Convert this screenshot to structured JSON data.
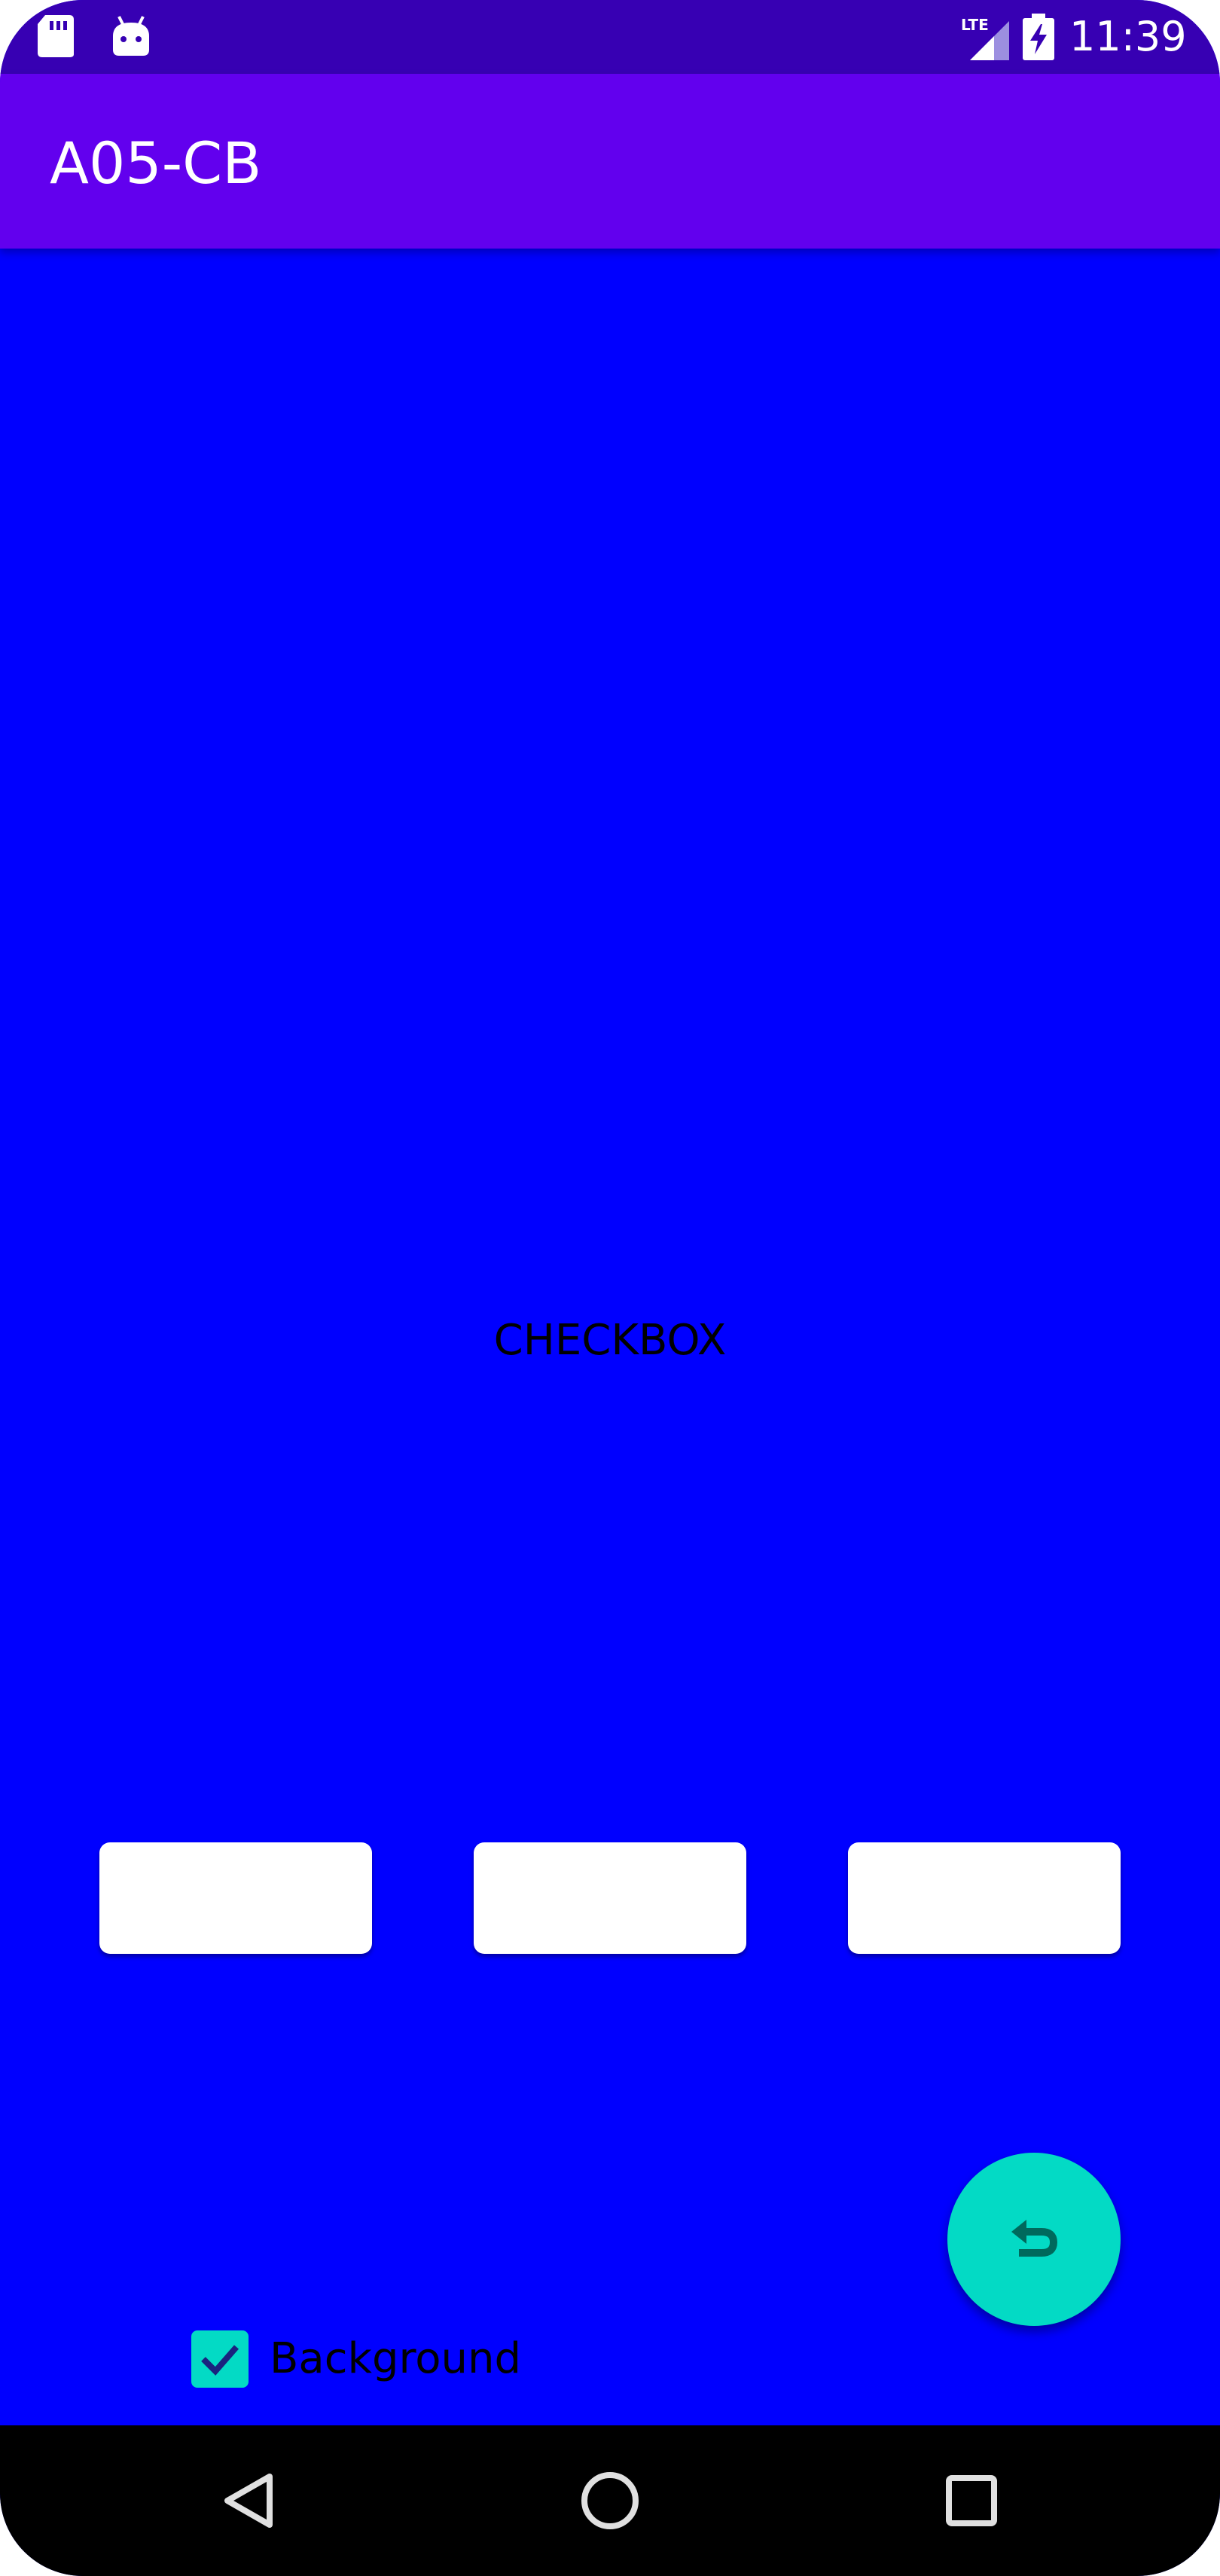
{
  "status_bar": {
    "time": "11:39",
    "network": "LTE",
    "icons": [
      "sd-card-icon",
      "android-icon",
      "lte-signal-icon",
      "battery-charging-icon"
    ]
  },
  "app_bar": {
    "title": "A05-CB"
  },
  "main": {
    "center_label": "CHECKBOX",
    "background_color": "#0000FF",
    "buttons": [
      "",
      "",
      ""
    ]
  },
  "fab": {
    "icon": "undo-icon",
    "color": "#03DAC5"
  },
  "checkbox": {
    "label": "Background",
    "checked": true
  },
  "nav_bar": {
    "icons": [
      "back-icon",
      "home-icon",
      "recents-icon"
    ]
  },
  "colors": {
    "status_bar": "#3700B3",
    "app_bar": "#6200EE",
    "accent": "#03DAC5"
  }
}
